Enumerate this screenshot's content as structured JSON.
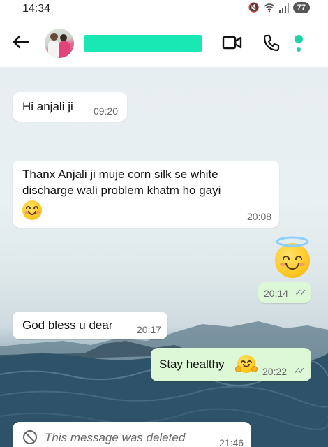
{
  "status_bar": {
    "time": "14:34",
    "battery": "77"
  },
  "header": {
    "contact_name": "",
    "icons": [
      "back-arrow-icon",
      "video-call-icon",
      "phone-call-icon",
      "more-options-icon"
    ],
    "accent": "#1fd3a6"
  },
  "messages": [
    {
      "direction": "incoming",
      "text": "Hi anjali ji",
      "time": "09:20"
    },
    {
      "direction": "incoming",
      "line1": "Thanx Anjali ji muje corn silk se white",
      "line2": "discharge wali problem khatm ho gayi",
      "emoji": "smiling-face-emoji",
      "time": "20:08"
    },
    {
      "direction": "outgoing",
      "emoji": "smiling-face-with-halo-emoji",
      "time": "20:14",
      "status": "read"
    },
    {
      "direction": "incoming",
      "text": "God bless u dear",
      "time": "20:17"
    },
    {
      "direction": "outgoing",
      "text": "Stay healthy",
      "emoji": "hugging-face-emoji",
      "time": "20:22",
      "status": "read"
    },
    {
      "direction": "incoming",
      "text": "This message was deleted",
      "time": "21:46",
      "deleted": true
    }
  ],
  "colors": {
    "incoming_bubble": "#ffffff",
    "outgoing_bubble": "#dcf8d6"
  }
}
